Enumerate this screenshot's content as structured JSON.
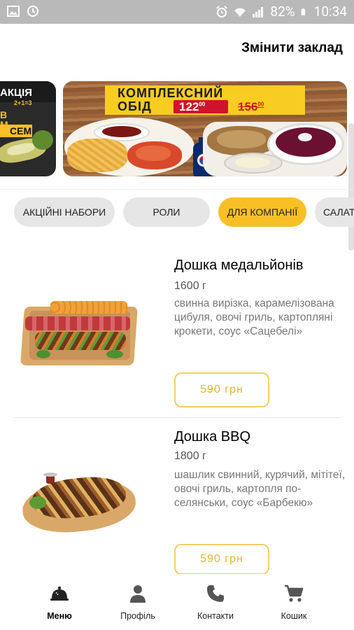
{
  "status_bar": {
    "battery_percent": "82%",
    "time": "10:34"
  },
  "header": {
    "change_venue_label": "Змінити заклад"
  },
  "banners": {
    "promo_small": {
      "line1": "АКЦІЯ",
      "line2": "2+1=3",
      "line3": "В",
      "line4": "М",
      "line5": "СЕМ"
    },
    "promo_main": {
      "title_line1": "КОМПЛЕКСНИЙ",
      "title_line2": "ОБІД",
      "new_price": "122",
      "new_price_cents": "00",
      "old_price": "156",
      "old_price_cents": "00"
    }
  },
  "categories": [
    {
      "label": "АКЦІЙНІ НАБОРИ",
      "active": false
    },
    {
      "label": "РОЛИ",
      "active": false
    },
    {
      "label": "ДЛЯ КОМПАНІЇ",
      "active": true
    },
    {
      "label": "САЛАТ",
      "active": false
    }
  ],
  "products": [
    {
      "name": "Дошка медальйонів",
      "weight": "1600 г",
      "description": "свинна вирізка, карамелізована цибуля, овочі гриль, картопляні крокети, соус «Сацебелі»",
      "price": "590 грн"
    },
    {
      "name": "Дошка BBQ",
      "weight": "1800 г",
      "description": "шашлик свинний, курячий, мітітеї, овочі гриль, картопля по-селянськи,  соус «Барбекю»",
      "price": "590 грн"
    }
  ],
  "bottom_nav": [
    {
      "label": "Меню",
      "icon": "cloche-icon",
      "active": true
    },
    {
      "label": "Профіль",
      "icon": "person-icon",
      "active": false
    },
    {
      "label": "Контакти",
      "icon": "phone-icon",
      "active": false
    },
    {
      "label": "Кошик",
      "icon": "cart-icon",
      "active": false
    }
  ],
  "colors": {
    "accent": "#f9bf26",
    "price_border": "#f3cf62",
    "price_text": "#e4b52f",
    "chip_bg": "#e6e6e6",
    "status_bar": "#b9b9b9"
  }
}
